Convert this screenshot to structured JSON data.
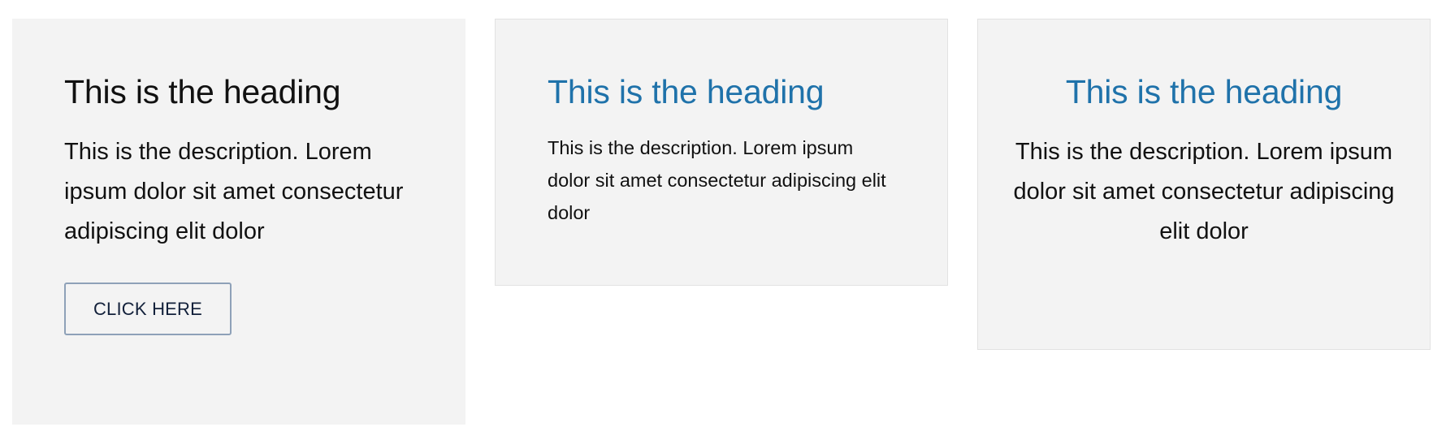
{
  "cards": [
    {
      "heading": "This is the heading",
      "description": "This is the description. Lorem ipsum dolor sit amet consectetur adipiscing elit dolor",
      "button_label": "CLICK HERE"
    },
    {
      "heading": "This is the heading",
      "description": "This is the description. Lorem ipsum dolor sit amet consectetur adipiscing elit dolor"
    },
    {
      "heading": "This is the heading",
      "description": "This is the description. Lorem ipsum dolor sit amet consectetur adipiscing elit dolor"
    }
  ],
  "colors": {
    "card_background": "#f3f3f3",
    "heading_accent": "#1f72aa",
    "button_border": "#8ea1b8",
    "text": "#111111"
  }
}
